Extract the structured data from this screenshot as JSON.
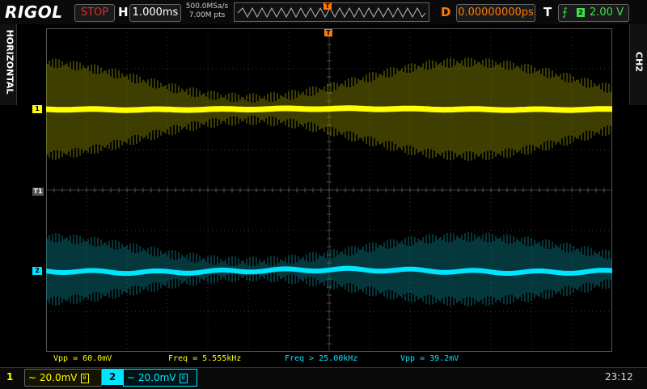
{
  "header": {
    "brand": "RIGOL",
    "run_state": "STOP",
    "horizontal_letter": "H",
    "timebase": "1.000ms",
    "sample_rate": "500.0MSa/s",
    "memory_depth": "7.00M pts",
    "delay_letter": "D",
    "delay": "0.00000000ps",
    "trigger_letter": "T",
    "trigger_source": "2",
    "trigger_level": "2.00 V",
    "trigger_edge_icon": "rising-edge-icon"
  },
  "side_tabs": {
    "left": "HORIZONTAL",
    "right": "CH2"
  },
  "markers": {
    "ch1": "1",
    "ch2": "2",
    "trigger_level": "T1",
    "trigger_position": "T"
  },
  "measurements": [
    {
      "text": "Vpp = 60.0mV",
      "channel": "1"
    },
    {
      "text": "Freq = 5.555kHz",
      "channel": "1"
    },
    {
      "text": "Freq > 25.00kHz",
      "channel": "2"
    },
    {
      "text": "Vpp = 39.2mV",
      "channel": "2"
    }
  ],
  "channels": {
    "ch1": {
      "number": "1",
      "coupling_icon": "ac-coupling-icon",
      "scale": "~ 20.0mV",
      "color": "#ffff00"
    },
    "ch2": {
      "number": "2",
      "coupling_icon": "ac-coupling-icon",
      "scale": "~ 20.0mV",
      "color": "#00e5ff"
    }
  },
  "status": {
    "clock": "23:12"
  }
}
